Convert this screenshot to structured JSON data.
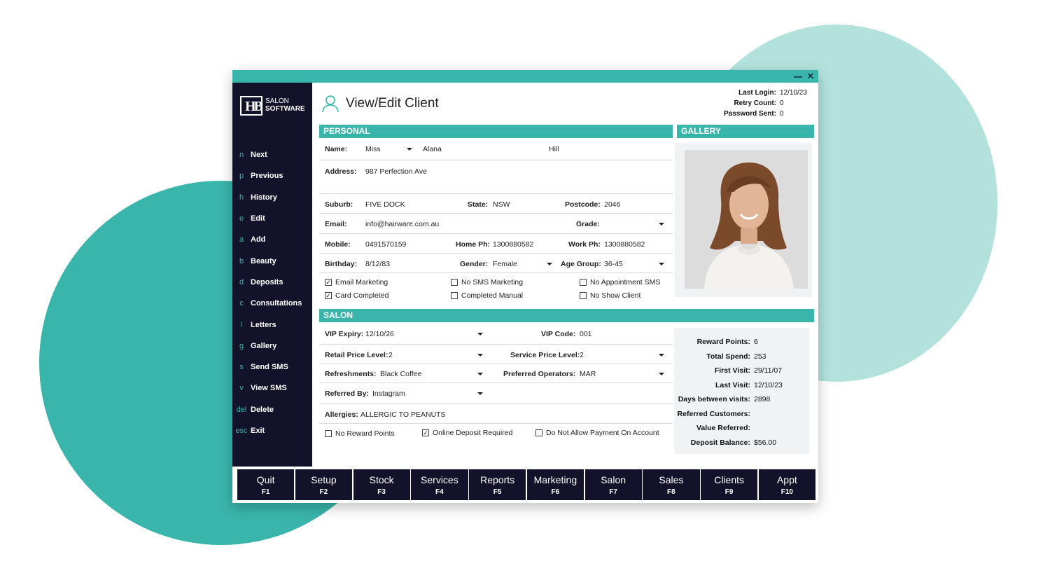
{
  "colors": {
    "accent": "#3ab5ab",
    "accent_light": "#b3e2dd",
    "dark": "#12122a",
    "panel": "#f1f2f4"
  },
  "window_controls": {
    "minimize": "minimize-icon",
    "close": "close-icon"
  },
  "logo": {
    "mark": "HB",
    "line1": "SALON",
    "line2": "SOFTWARE"
  },
  "sidebar": {
    "items": [
      {
        "key": "n",
        "label": "Next"
      },
      {
        "key": "p",
        "label": "Previous"
      },
      {
        "key": "h",
        "label": "History"
      },
      {
        "key": "e",
        "label": "Edit"
      },
      {
        "key": "a",
        "label": "Add"
      },
      {
        "key": "b",
        "label": "Beauty"
      },
      {
        "key": "d",
        "label": "Deposits"
      },
      {
        "key": "c",
        "label": "Consultations"
      },
      {
        "key": "l",
        "label": "Letters"
      },
      {
        "key": "g",
        "label": "Gallery"
      },
      {
        "key": "s",
        "label": "Send SMS"
      },
      {
        "key": "v",
        "label": "View SMS"
      },
      {
        "key": "del",
        "label": "Delete"
      },
      {
        "key": "esc",
        "label": "Exit"
      }
    ]
  },
  "header": {
    "title": "View/Edit Client",
    "icon": "person-outline-icon",
    "last_login_label": "Last Login:",
    "last_login": "12/10/23",
    "retry_count_label": "Retry Count:",
    "retry_count": "0",
    "password_sent_label": "Password Sent:",
    "password_sent": "0"
  },
  "personal": {
    "section_title": "PERSONAL",
    "name_label": "Name:",
    "title_value": "Miss",
    "first_name": "Alana",
    "last_name": "Hill",
    "address_label": "Address:",
    "address": "987 Perfection Ave",
    "suburb_label": "Suburb:",
    "suburb": "FIVE DOCK",
    "state_label": "State:",
    "state": "NSW",
    "postcode_label": "Postcode:",
    "postcode": "2046",
    "email_label": "Email:",
    "email": "info@hairware.com.au",
    "grade_label": "Grade:",
    "grade": "",
    "mobile_label": "Mobile:",
    "mobile": "0491570159",
    "home_ph_label": "Home Ph:",
    "home_ph": "1300880582",
    "work_ph_label": "Work Ph:",
    "work_ph": "1300880582",
    "birthday_label": "Birthday:",
    "birthday": "8/12/83",
    "gender_label": "Gender:",
    "gender": "Female",
    "age_group_label": "Age Group:",
    "age_group": "36-45",
    "checkboxes": [
      {
        "label": "Email Marketing",
        "checked": true
      },
      {
        "label": "No SMS Marketing",
        "checked": false
      },
      {
        "label": "No Appointment SMS",
        "checked": false
      },
      {
        "label": "Card Completed",
        "checked": true
      },
      {
        "label": "Completed Manual",
        "checked": false
      },
      {
        "label": "No Show Client",
        "checked": false
      }
    ]
  },
  "gallery": {
    "section_title": "GALLERY"
  },
  "salon": {
    "section_title": "SALON",
    "vip_expiry_label": "VIP Expiry:",
    "vip_expiry": "12/10/26",
    "vip_code_label": "VIP Code:",
    "vip_code": "001",
    "retail_price_label": "Retail Price Level:",
    "retail_price": "2",
    "service_price_label": "Service Price Level:",
    "service_price": "2",
    "refreshments_label": "Refreshments:",
    "refreshments": "Black Coffee",
    "preferred_operators_label": "Preferred Operators:",
    "preferred_operators": "MAR",
    "referred_by_label": "Referred By:",
    "referred_by": "Instagram",
    "allergies_label": "Allergies:",
    "allergies": "ALLERGIC TO PEANUTS",
    "checkboxes": [
      {
        "label": "No Reward Points",
        "checked": false
      },
      {
        "label": "Online Deposit Required",
        "checked": true
      },
      {
        "label": "Do Not Allow Payment On Account",
        "checked": false
      }
    ],
    "stats": [
      {
        "label": "Reward Points:",
        "value": "6"
      },
      {
        "label": "Total Spend:",
        "value": "253"
      },
      {
        "label": "First Visit:",
        "value": "29/11/07"
      },
      {
        "label": "Last Visit:",
        "value": "12/10/23"
      },
      {
        "label": "Days between visits:",
        "value": "2898"
      },
      {
        "label": "Referred Customers:",
        "value": ""
      },
      {
        "label": "Value Referred:",
        "value": ""
      },
      {
        "label": "Deposit Balance:",
        "value": "$56.00"
      }
    ]
  },
  "function_keys": [
    {
      "label": "Quit",
      "code": "F1"
    },
    {
      "label": "Setup",
      "code": "F2"
    },
    {
      "label": "Stock",
      "code": "F3"
    },
    {
      "label": "Services",
      "code": "F4"
    },
    {
      "label": "Reports",
      "code": "F5"
    },
    {
      "label": "Marketing",
      "code": "F6"
    },
    {
      "label": "Salon",
      "code": "F7"
    },
    {
      "label": "Sales",
      "code": "F8"
    },
    {
      "label": "Clients",
      "code": "F9"
    },
    {
      "label": "Appt",
      "code": "F10"
    }
  ]
}
